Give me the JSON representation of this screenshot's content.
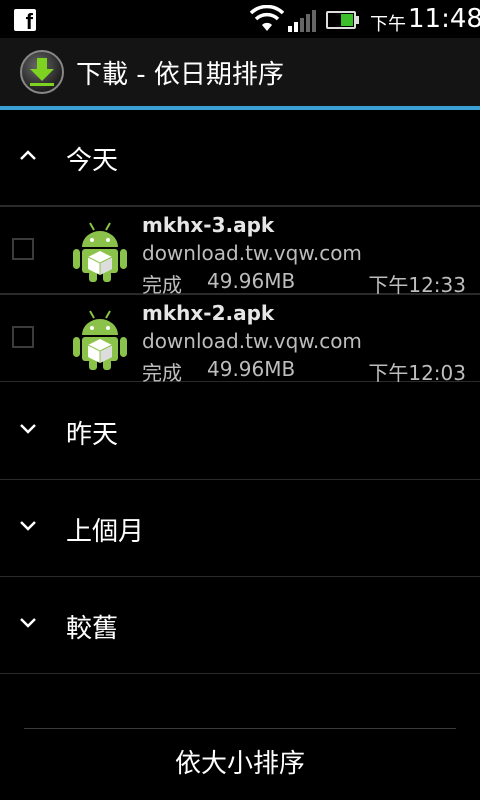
{
  "status_bar": {
    "notification_icon": "facebook-icon",
    "fb_letter": "f",
    "time_period": "下午",
    "time": "11:48",
    "battery_color": "#3cbf2a"
  },
  "header": {
    "title": "下載 - 依日期排序",
    "accent_color": "#3aa0d6"
  },
  "groups": [
    {
      "label": "今天",
      "expanded": true,
      "items": [
        {
          "filename": "mkhx-3.apk",
          "source": "download.tw.vqw.com",
          "status": "完成",
          "size": "49.96MB",
          "time": "下午12:33"
        },
        {
          "filename": "mkhx-2.apk",
          "source": "download.tw.vqw.com",
          "status": "完成",
          "size": "49.96MB",
          "time": "下午12:03"
        }
      ]
    },
    {
      "label": "昨天",
      "expanded": false
    },
    {
      "label": "上個月",
      "expanded": false
    },
    {
      "label": "較舊",
      "expanded": false
    }
  ],
  "footer": {
    "sort_button_label": "依大小排序"
  }
}
